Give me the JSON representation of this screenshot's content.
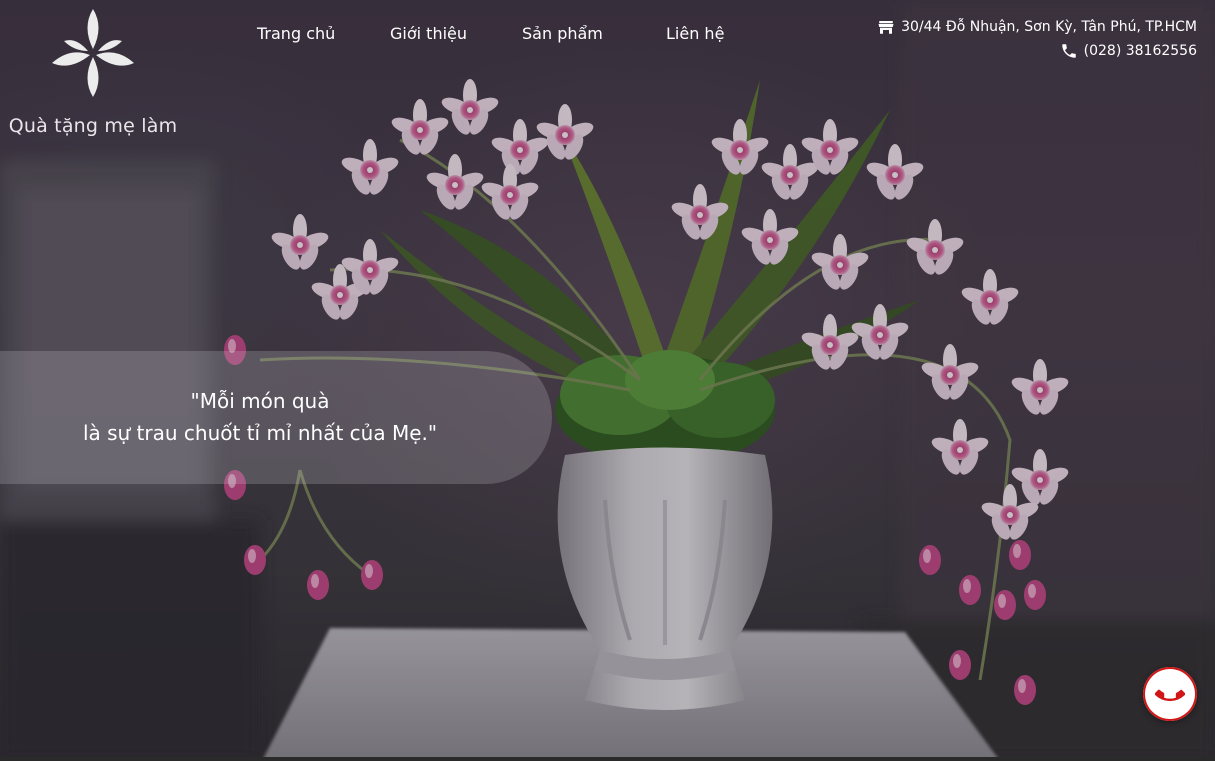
{
  "brand": {
    "name": "Quà tặng mẹ làm",
    "logo_icon": "four-petal-flower-icon"
  },
  "nav": {
    "items": [
      {
        "label": "Trang chủ"
      },
      {
        "label": "Giới thiệu"
      },
      {
        "label": "Sản phẩm"
      },
      {
        "label": "Liên hệ"
      }
    ]
  },
  "contact": {
    "address": "30/44 Đỗ Nhuận, Sơn Kỳ, Tân Phú, TP.HCM",
    "address_icon": "store-icon",
    "phone": "(028) 38162556",
    "phone_icon": "phone-icon"
  },
  "hero": {
    "quote_line1": "\"Mỗi món quà",
    "quote_line2": "là sự trau chuốt tỉ mỉ nhất của Mẹ.\""
  },
  "call_button": {
    "icon": "phone-call-icon",
    "accent": "#d01616"
  },
  "colors": {
    "flower_pink": "#c2477f",
    "flower_white": "#f1e6ee",
    "leaf_green": "#3f6b2a",
    "vase_white": "#dcdcdc"
  }
}
